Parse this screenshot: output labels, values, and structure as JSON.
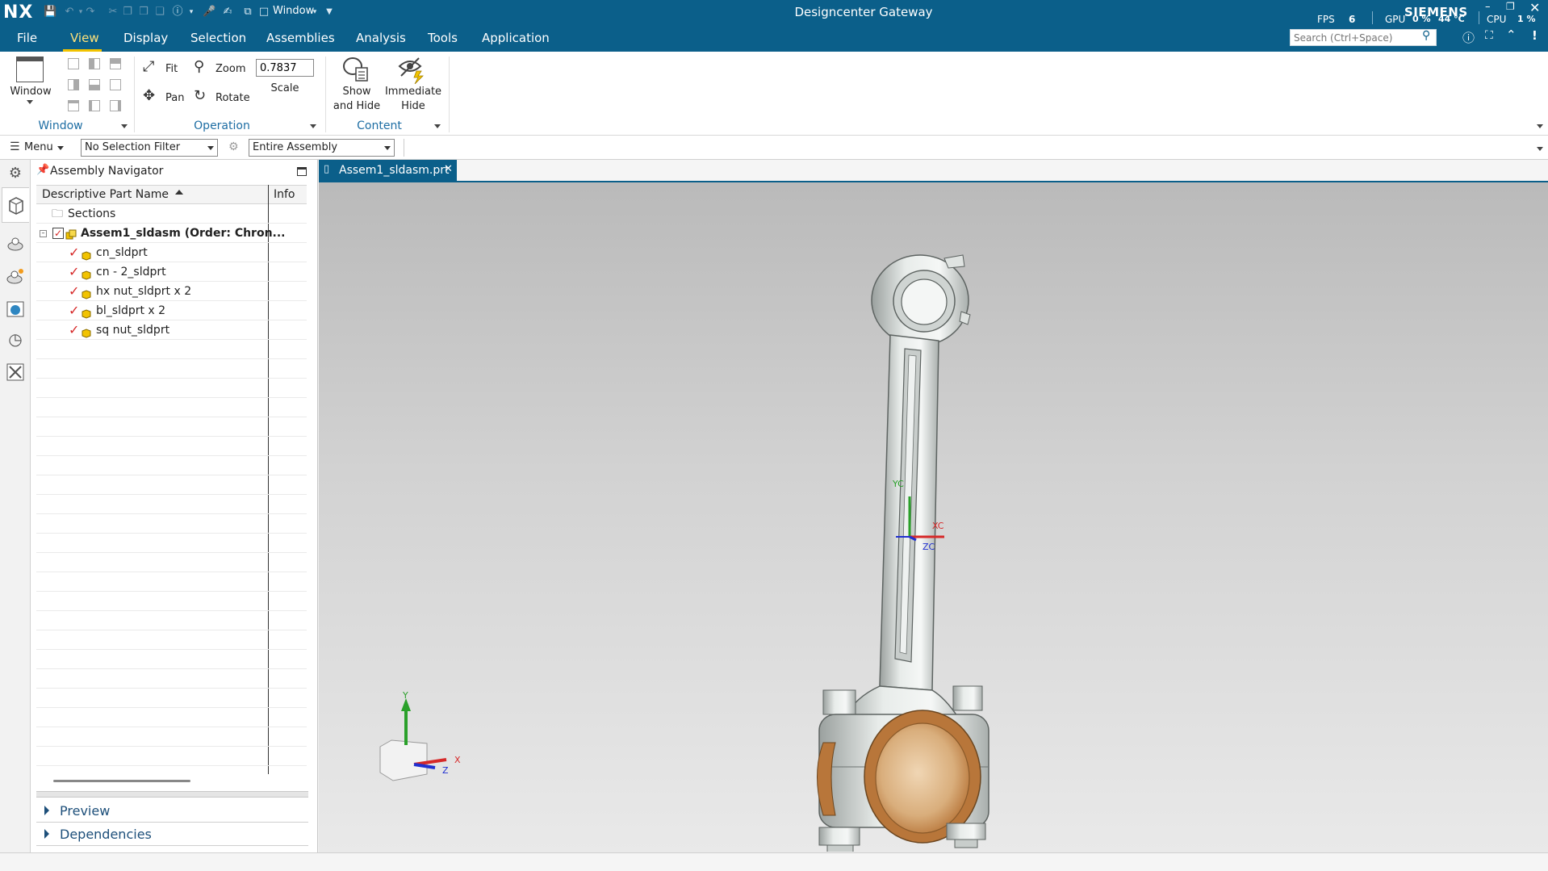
{
  "app": {
    "logo": "NX",
    "window_menu": "Window",
    "title": "Designcenter Gateway",
    "brand": "SIEMENS",
    "fps_label": "FPS",
    "fps_value": "6",
    "gpu_label": "GPU",
    "gpu_value": "0 %",
    "gpu_temp": "44 °C",
    "cpu_label": "CPU",
    "cpu_value": "1 %"
  },
  "menu": {
    "items": [
      "File",
      "View",
      "Display",
      "Selection",
      "Assemblies",
      "Analysis",
      "Tools",
      "Application"
    ],
    "active": "View",
    "search_placeholder": "Search (Ctrl+Space)"
  },
  "ribbon": {
    "window_button": "Window",
    "window_group": "Window",
    "fit": "Fit",
    "zoom": "Zoom",
    "pan": "Pan",
    "rotate": "Rotate",
    "scale_value": "0.7837",
    "scale_label": "Scale",
    "operation_group": "Operation",
    "show_hide_line1": "Show",
    "show_hide_line2": "and Hide",
    "immediate_hide_line1": "Immediate",
    "immediate_hide_line2": "Hide",
    "content_group": "Content"
  },
  "filterbar": {
    "menu_label": "Menu",
    "selection_filter": "No Selection Filter",
    "scope": "Entire Assembly"
  },
  "navigator": {
    "title": "Assembly Navigator",
    "col_name": "Descriptive Part Name",
    "col_info": "Info",
    "sections": "Sections",
    "root": "Assem1_sldasm (Order: Chron...",
    "parts": [
      "cn_sldprt",
      "cn - 2_sldprt",
      "hx nut_sldprt x 2",
      "bl_sldprt x 2",
      "sq nut_sldprt"
    ],
    "preview": "Preview",
    "dependencies": "Dependencies"
  },
  "graphics": {
    "tab_label": "Assem1_sldasm.prt",
    "wcs_yc": "YC",
    "wcs_xc": "XC",
    "wcs_zc": "ZC",
    "triad_x": "X",
    "triad_y": "Y",
    "triad_z": "Z"
  },
  "colors": {
    "brand_blue": "#0b5f8a",
    "accent_yellow": "#f2c300",
    "check_red": "#d62828",
    "bushing_bronze": "#b8763a"
  }
}
